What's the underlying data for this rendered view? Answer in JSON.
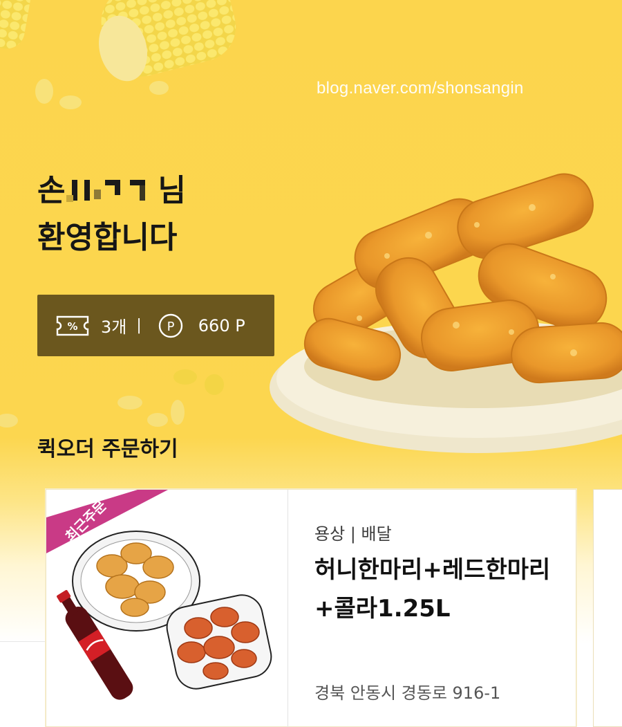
{
  "watermark": "blog.naver.com/shonsangin",
  "greeting": {
    "line1_prefix": "손",
    "line1_suffix": "님",
    "line2": "환영합니다"
  },
  "coupon_bar": {
    "coupon_icon": "coupon-ticket-icon",
    "coupon_count": "3개",
    "separator": "|",
    "point_icon": "point-circle-icon",
    "points": "660 P"
  },
  "quick_order": {
    "title": "퀵오더 주문하기",
    "cards": [
      {
        "badge": "최근주문",
        "store_type": "용상 | 배달",
        "menu_name": "허니한마리+레드한마리+콜라1.25L",
        "address": "경북 안동시 경동로 916-1"
      }
    ]
  },
  "colors": {
    "hero_yellow": "#fcd54d",
    "coupon_bar_bg": "#6b571e",
    "badge_magenta": "#c93a86"
  }
}
